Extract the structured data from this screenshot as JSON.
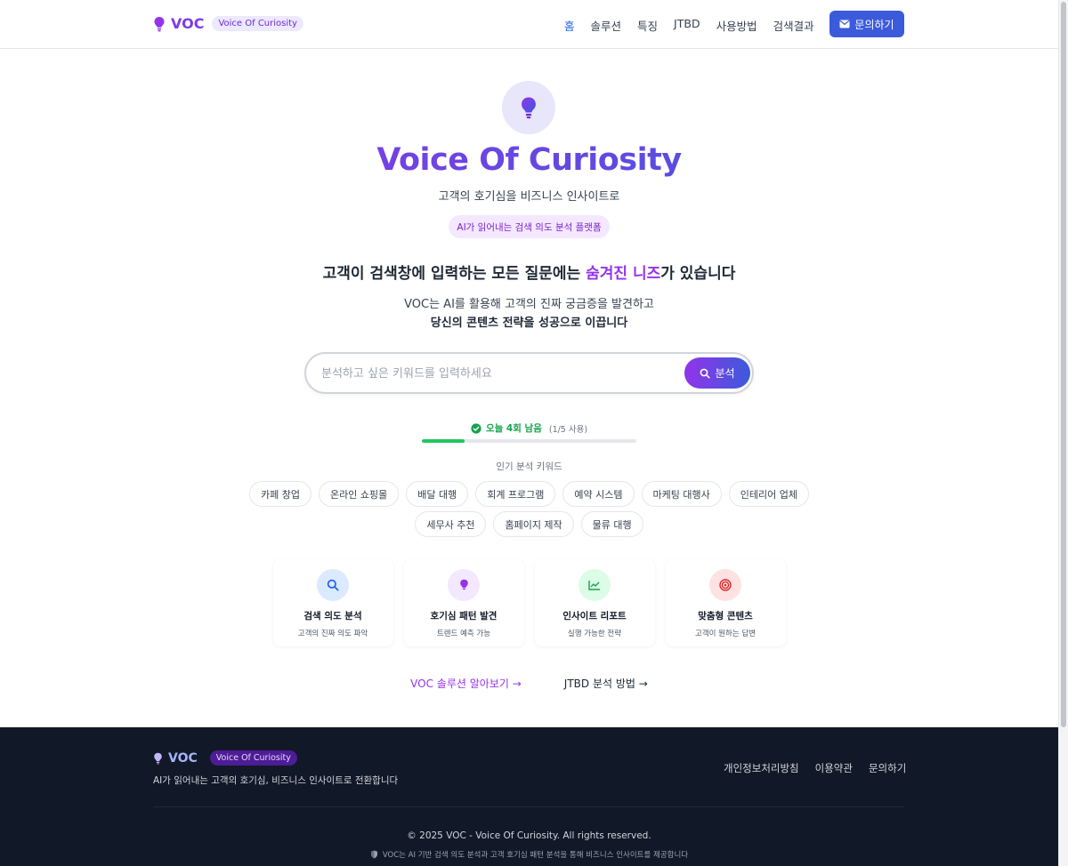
{
  "header": {
    "logo_text": "VOC",
    "logo_badge": "Voice Of Curiosity",
    "nav": [
      "홈",
      "솔루션",
      "특징",
      "JTBD",
      "사용방법",
      "검색결과"
    ],
    "contact_label": "문의하기"
  },
  "hero": {
    "title": "Voice Of Curiosity",
    "subtitle": "고객의 호기심을 비즈니스 인사이트로",
    "pill": "AI가 읽어내는 검색 의도 분석 플랫폼",
    "headline_pre": "고객이 검색창에 입력하는 모든 질문에는 ",
    "headline_highlight": "숨겨진 니즈",
    "headline_post": "가 있습니다",
    "desc1": "VOC는 AI를 활용해 고객의 진짜 궁금증을 발견하고",
    "desc2": "당신의 콘텐츠 전략을 성공으로 이끕니다"
  },
  "search": {
    "placeholder": "분석하고 싶은 키워드를 입력하세요",
    "value": "",
    "button_label": "분석"
  },
  "usage": {
    "remaining_text": "오늘 4회 남음",
    "used_text": "(1/5 사용)",
    "progress_fraction": 0.2
  },
  "keywords": {
    "label": "인기 분석 키워드",
    "row1": [
      "카페 창업",
      "온라인 쇼핑몰",
      "배달 대행",
      "회계 프로그램",
      "예약 시스템",
      "마케팅 대행사",
      "인테리어 업체"
    ],
    "row2": [
      "세무사 추천",
      "홈페이지 제작",
      "물류 대행"
    ]
  },
  "features": [
    {
      "icon": "search-icon",
      "title": "검색 의도 분석",
      "sub": "고객의 진짜 의도 파악",
      "bg": "#dbeafe",
      "fg": "#2563eb"
    },
    {
      "icon": "lightbulb-icon",
      "title": "호기심 패턴 발견",
      "sub": "트렌드 예측 가능",
      "bg": "#f3e8ff",
      "fg": "#9333ea"
    },
    {
      "icon": "chart-line-icon",
      "title": "인사이트 리포트",
      "sub": "실행 가능한 전략",
      "bg": "#dcfce7",
      "fg": "#16a34a"
    },
    {
      "icon": "target-icon",
      "title": "맞춤형 콘텐츠",
      "sub": "고객이 원하는 답변",
      "bg": "#fee2e2",
      "fg": "#dc2626"
    }
  ],
  "links": {
    "solution": "VOC 솔루션 알아보기",
    "jtbd": "JTBD 분석 방법"
  },
  "footer": {
    "logo_text": "VOC",
    "logo_badge": "Voice Of Curiosity",
    "desc": "AI가 읽어내는 고객의 호기심, 비즈니스 인사이트로 전환합니다",
    "links": [
      "개인정보처리방침",
      "이용약관",
      "문의하기"
    ],
    "copyright": "© 2025 VOC - Voice Of Curiosity. All rights reserved.",
    "note": "VOC는 AI 기반 검색 의도 분석과 고객 호기심 패턴 분석을 통해 비즈니스 인사이트를 제공합니다"
  },
  "colors": {
    "brand_purple": "#9333ea",
    "brand_blue": "#3b5bdb",
    "success": "#22c55e",
    "footer_bg": "#111827"
  }
}
